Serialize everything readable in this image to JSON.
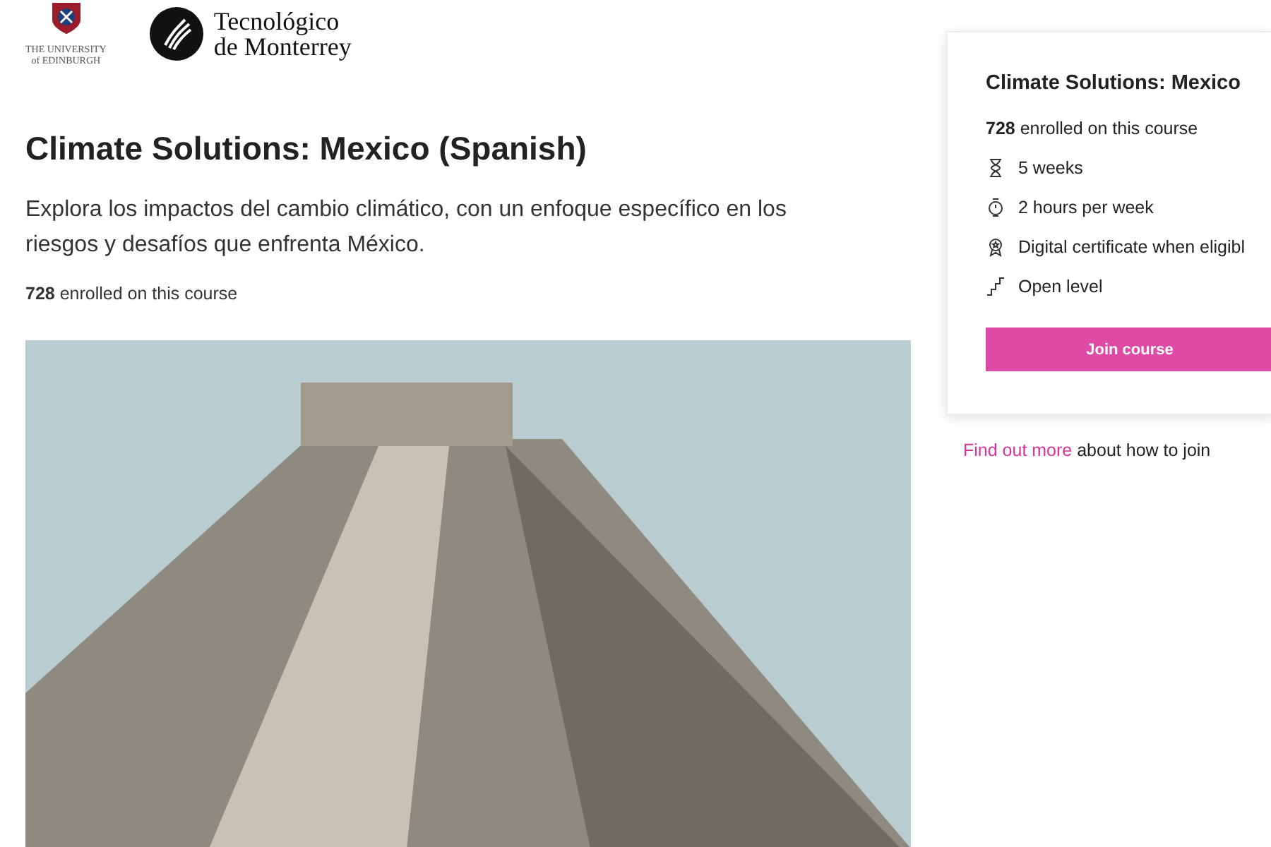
{
  "logos": [
    {
      "kind": "edinburgh",
      "lines": [
        "THE UNIVERSITY",
        "of EDINBURGH"
      ]
    },
    {
      "kind": "monterrey",
      "lines": [
        "Tecnológico",
        "de Monterrey"
      ]
    }
  ],
  "course": {
    "title": "Climate Solutions: Mexico (Spanish)",
    "description": "Explora los impactos del cambio climático, con un enfoque específico en los riesgos y desafíos que enfrenta México.",
    "enrolled": "**728** enrolled on this course"
  },
  "card": {
    "title": "Climate Solutions: Mexico",
    "enrolled": "**728** enrolled on this course",
    "facts": [
      {
        "kind": "duration",
        "text": "5 weeks"
      },
      {
        "kind": "effort",
        "text": "2 hours per week"
      },
      {
        "kind": "certificate",
        "text": "Digital certificate when eligibl"
      },
      {
        "kind": "level",
        "text": "Open level"
      }
    ],
    "button": "Join course"
  },
  "join_note": {
    "link": "Find out more",
    "text": "about how to join"
  }
}
